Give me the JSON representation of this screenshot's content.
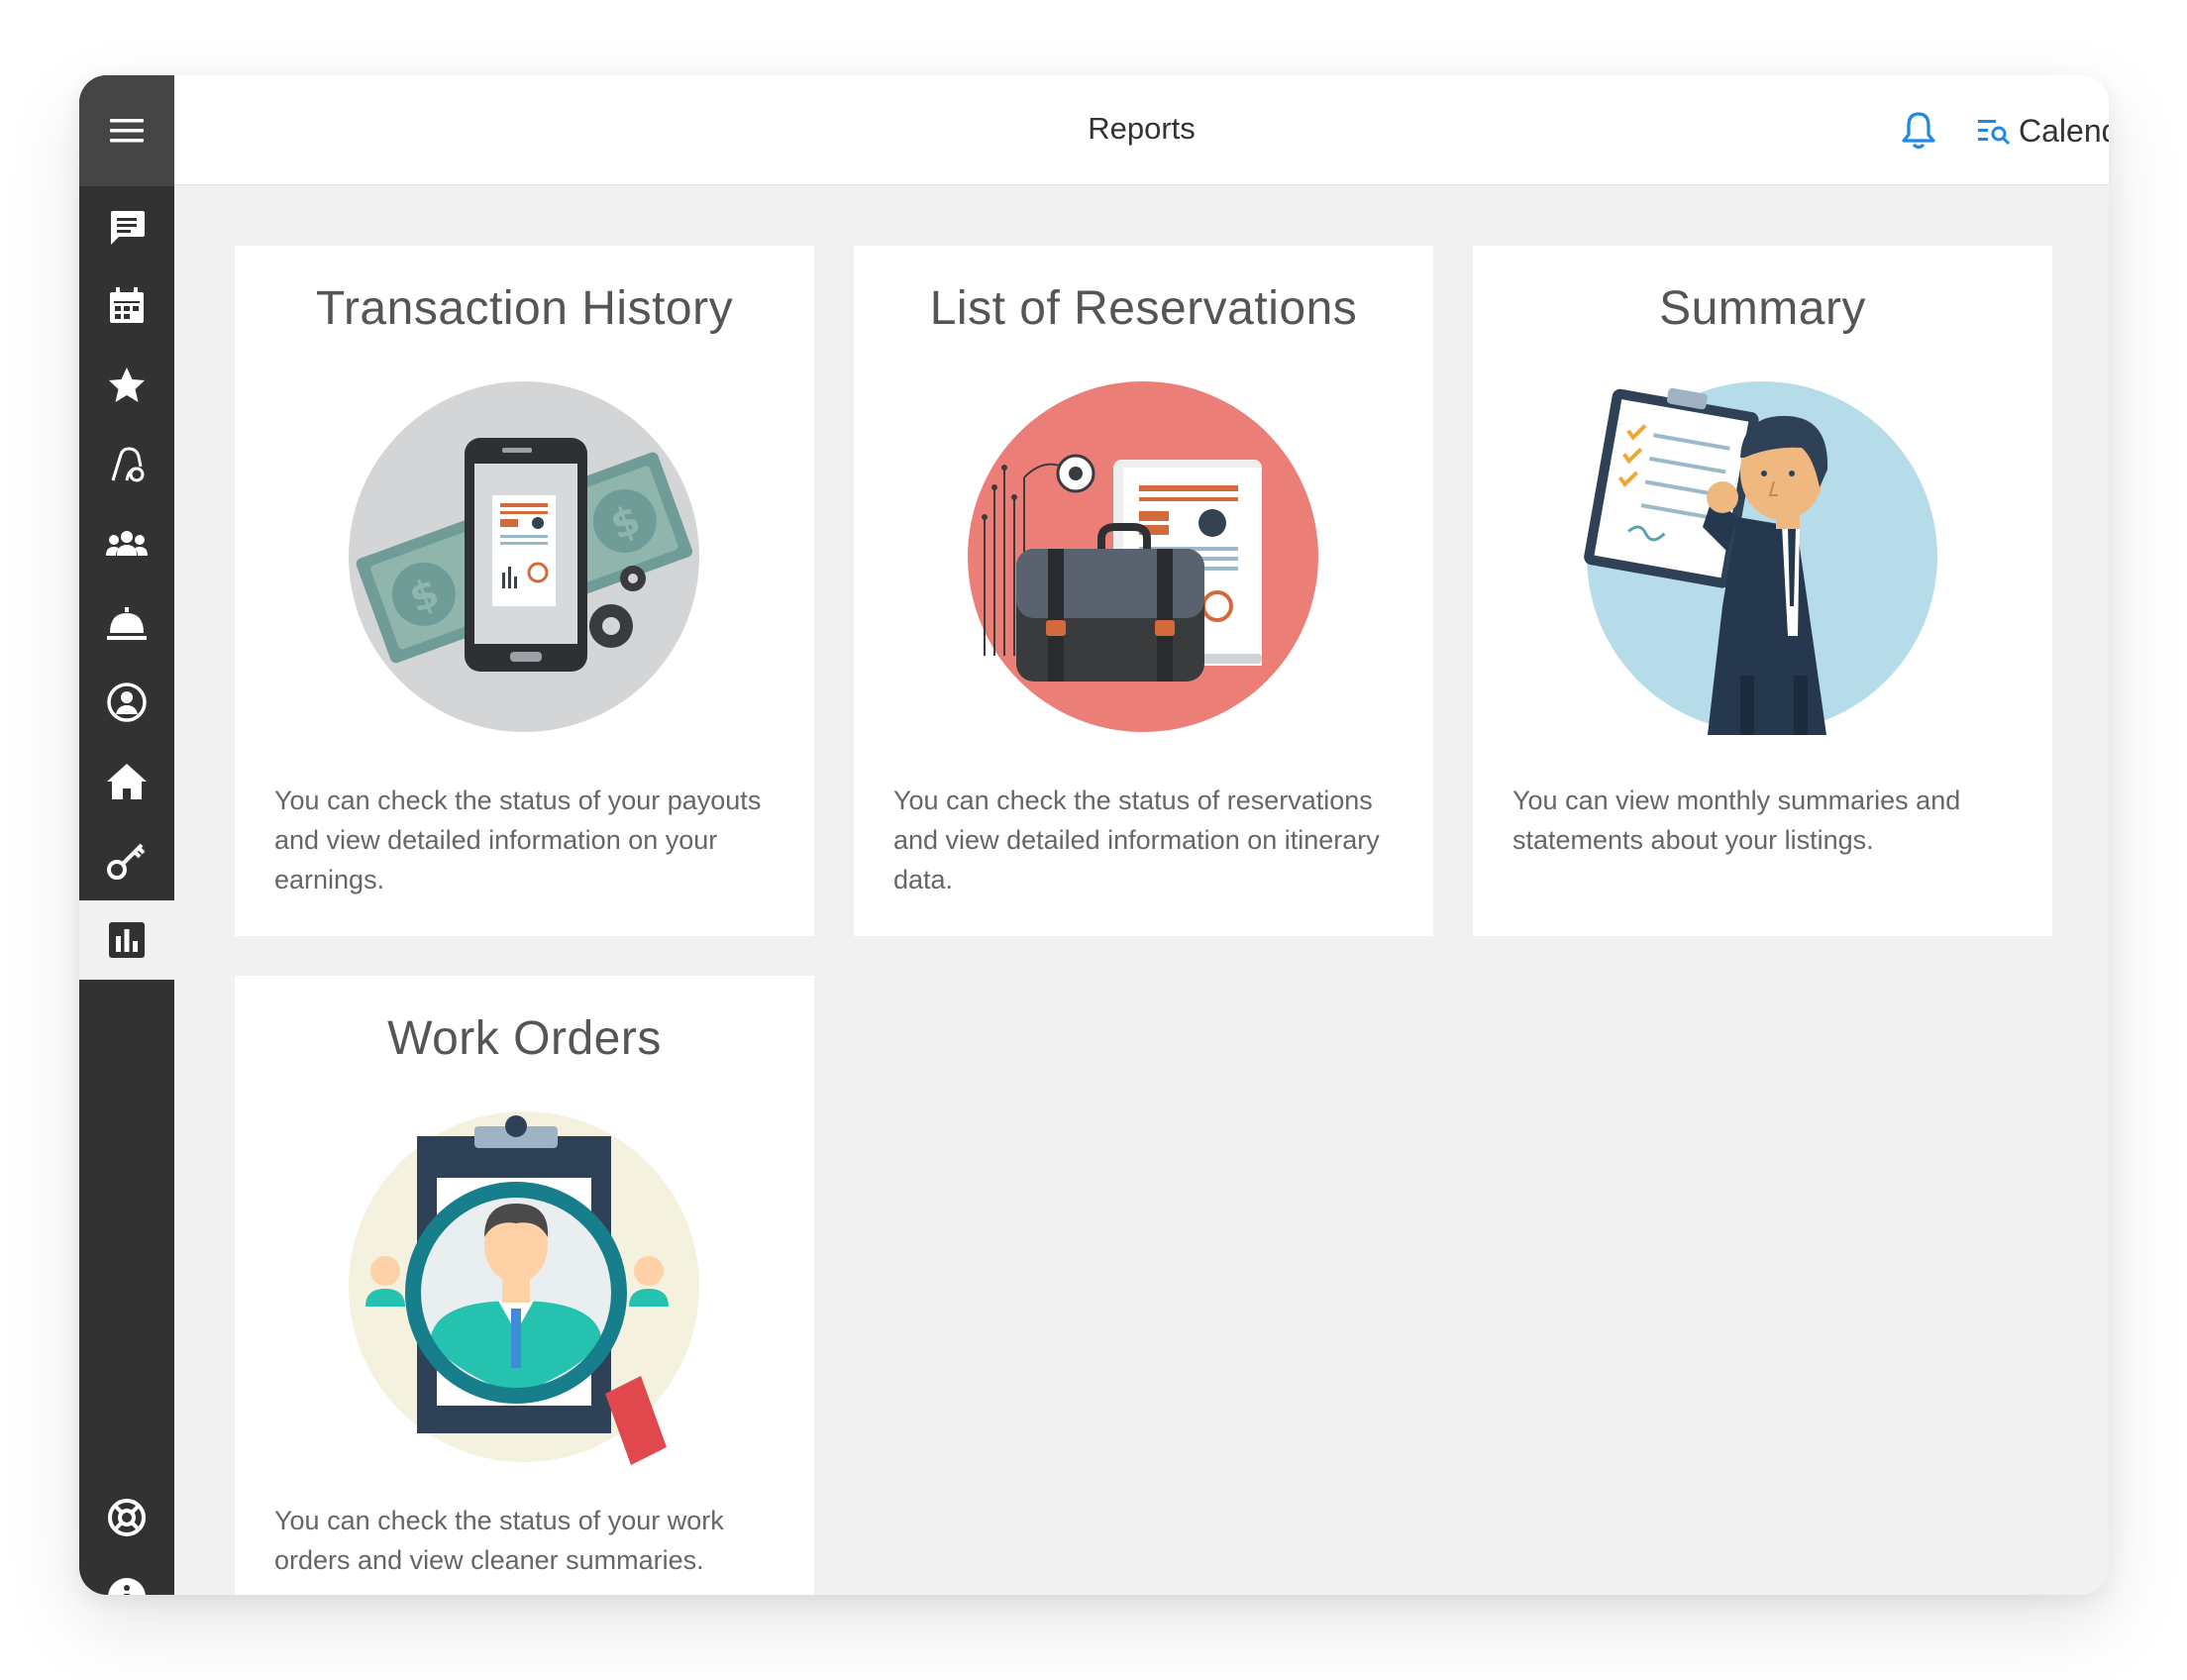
{
  "header": {
    "title": "Reports",
    "calendar_label": "Calendar"
  },
  "sidebar": {
    "items": [
      {
        "icon": "message-icon"
      },
      {
        "icon": "calendar-icon"
      },
      {
        "icon": "star-icon"
      },
      {
        "icon": "vacuum-icon"
      },
      {
        "icon": "people-icon"
      },
      {
        "icon": "service-bell-icon"
      },
      {
        "icon": "user-circle-icon"
      },
      {
        "icon": "home-icon"
      },
      {
        "icon": "key-icon"
      },
      {
        "icon": "bar-chart-icon",
        "active": true
      },
      {
        "icon": "lifebuoy-icon"
      },
      {
        "icon": "info-icon"
      }
    ]
  },
  "cards": [
    {
      "title": "Transaction History",
      "description": "You can check the status of your payouts and view detailed information on your earnings.",
      "illustration": "phone-money-illustration"
    },
    {
      "title": "List of Reservations",
      "description": "You can check the status of reservations and view detailed information on itinerary data.",
      "illustration": "briefcase-report-illustration"
    },
    {
      "title": "Summary",
      "description": "You can view monthly summaries and statements about your listings.",
      "illustration": "businessman-clipboard-illustration"
    },
    {
      "title": "Work Orders",
      "description": "You can check the status of your work orders and view cleaner summaries.",
      "illustration": "magnifier-person-illustration"
    }
  ],
  "colors": {
    "sidebar": "#323232",
    "accent": "#1e88e5",
    "background": "#f1f1f1"
  }
}
